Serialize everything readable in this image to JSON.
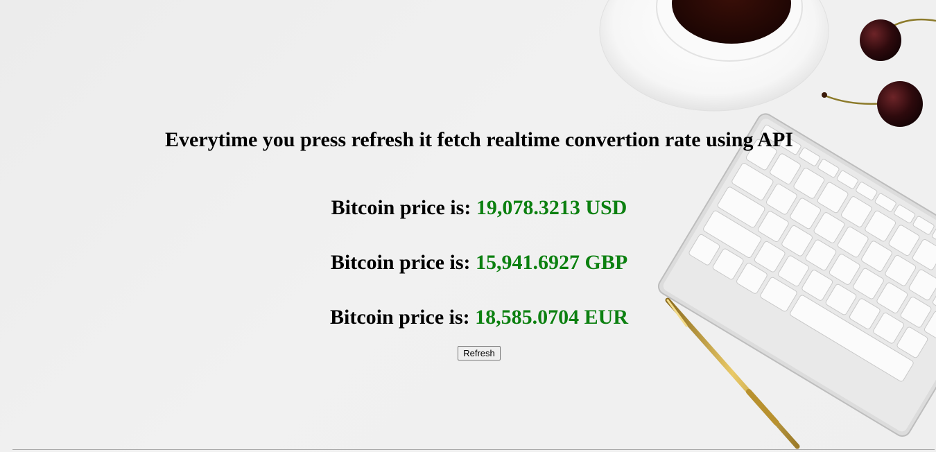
{
  "header": {
    "title": "Everytime you press refresh it fetch realtime convertion rate using API"
  },
  "prices": [
    {
      "label": "Bitcoin price is:",
      "value": "19,078.3213 USD"
    },
    {
      "label": "Bitcoin price is:",
      "value": "15,941.6927 GBP"
    },
    {
      "label": "Bitcoin price is:",
      "value": "18,585.0704 EUR"
    }
  ],
  "refresh_button": {
    "label": "Refresh"
  },
  "colors": {
    "background": "#efefef",
    "price_value": "#0c8010",
    "text": "#000000"
  },
  "background_image": {
    "icons": [
      "coffee-cup-icon",
      "cherries-icon",
      "keyboard-icon",
      "pen-icon"
    ]
  }
}
